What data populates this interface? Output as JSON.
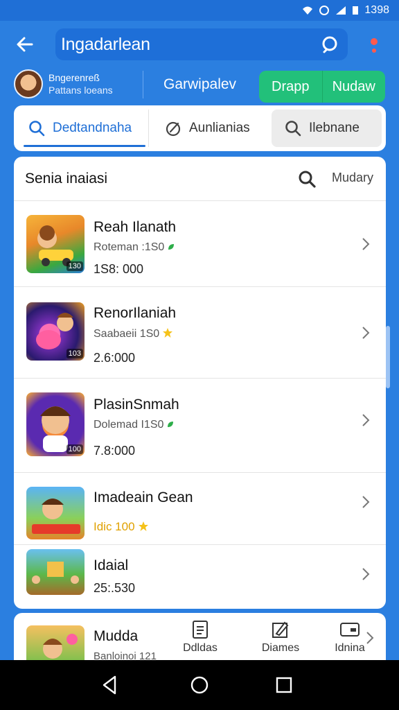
{
  "status": {
    "time": "1398"
  },
  "appbar": {
    "search_text": "Ingadarlean"
  },
  "profile": {
    "name": "Bngerenreß",
    "subtitle": "Pattans loeans",
    "game": "Garwipalev",
    "btn1": "Drapp",
    "btn2": "Nudaw"
  },
  "tabs": [
    {
      "label": "Dedtandnaha"
    },
    {
      "label": "Aunlianias"
    },
    {
      "label": "Ilebnane"
    }
  ],
  "list": {
    "header": "Senia inaiasi",
    "sort_label": "Mudary",
    "rows": [
      {
        "title": "Reah Ilanath",
        "subtitle": "Roteman :1S0",
        "value": "1S8: 000",
        "badge": "130"
      },
      {
        "title": "RenorIlaniah",
        "subtitle": "Saabaeii 1S0",
        "value": "2.6:000",
        "badge": "103"
      },
      {
        "title": "PlasinSnmah",
        "subtitle": "Dolemad I1S0",
        "value": "7.8:000",
        "badge": "100"
      },
      {
        "title": "Imadeain Gean",
        "subtitle": "Idic 100",
        "value": ""
      },
      {
        "title": "Idaial",
        "subtitle": "",
        "value": "25:.530"
      }
    ]
  },
  "bottom": {
    "title": "Mudda",
    "subtitle": "Banloinoi 121",
    "nav": [
      {
        "label": "Ddldas"
      },
      {
        "label": "Diames"
      },
      {
        "label": "Idnina"
      }
    ]
  },
  "colors": {
    "primary": "#2b7fe0",
    "accent_green": "#22c07a"
  }
}
